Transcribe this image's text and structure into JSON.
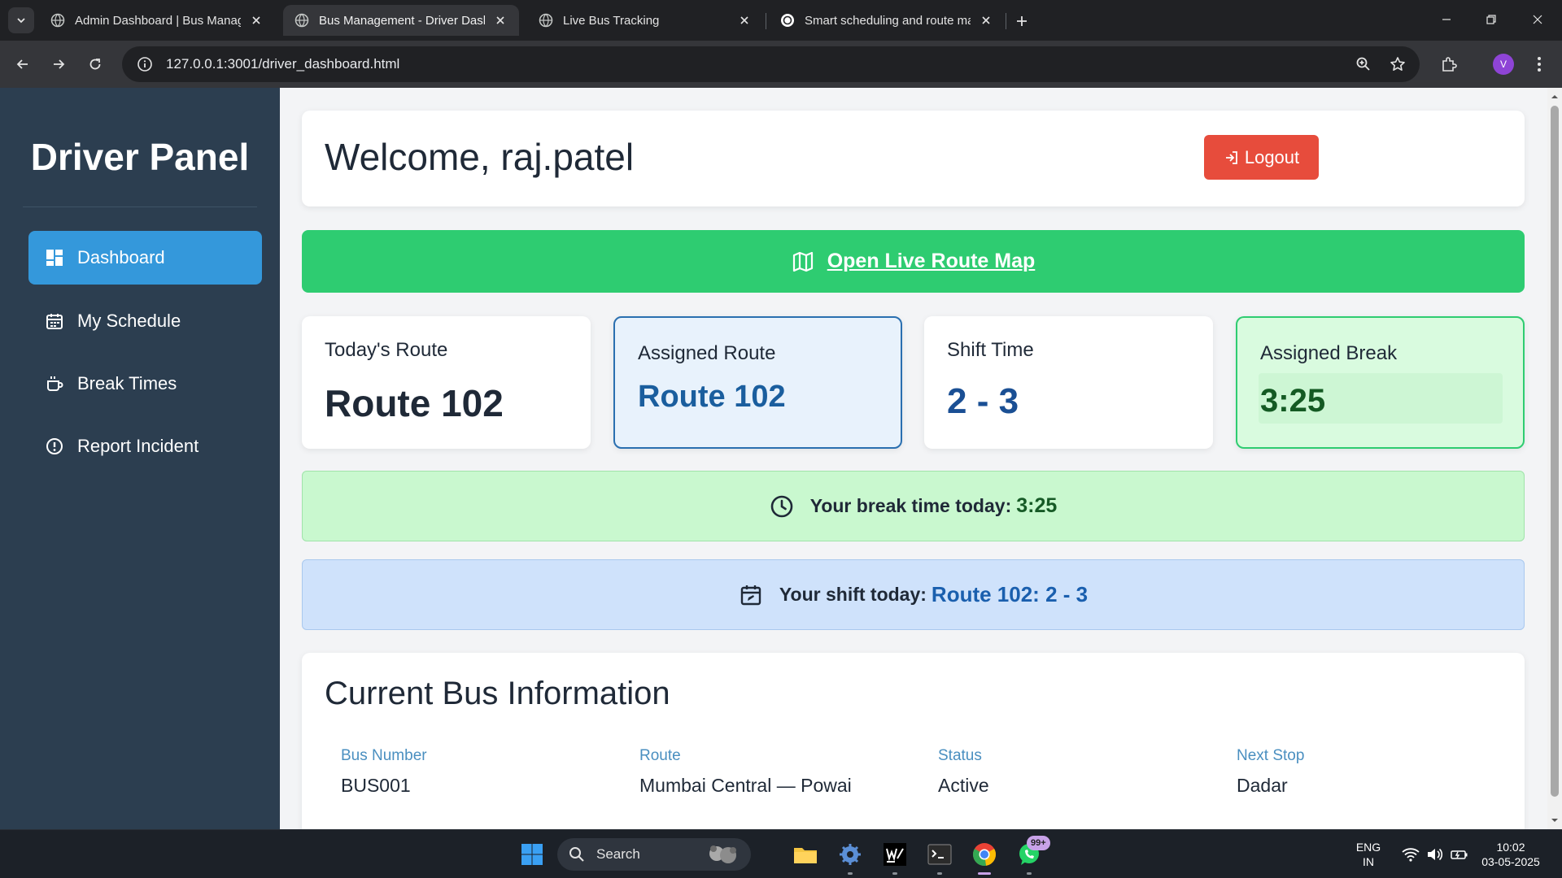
{
  "browser": {
    "tabs": [
      {
        "title": "Admin Dashboard | Bus Management",
        "active": false
      },
      {
        "title": "Bus Management - Driver Dashboard",
        "active": true
      },
      {
        "title": "Live Bus Tracking",
        "active": false
      },
      {
        "title": "Smart scheduling and route management",
        "active": false
      }
    ],
    "url": "127.0.0.1:3001/driver_dashboard.html",
    "profile_initial": "V"
  },
  "sidebar": {
    "title": "Driver Panel",
    "items": [
      {
        "label": "Dashboard",
        "icon": "dashboard-icon",
        "active": true
      },
      {
        "label": "My Schedule",
        "icon": "calendar-icon",
        "active": false
      },
      {
        "label": "Break Times",
        "icon": "coffee-icon",
        "active": false
      },
      {
        "label": "Report Incident",
        "icon": "alert-circle-icon",
        "active": false
      }
    ]
  },
  "header": {
    "welcome": "Welcome, raj.patel",
    "logout_label": "Logout"
  },
  "map_banner": {
    "label": "Open Live Route Map",
    "icon": "map-icon"
  },
  "stats": [
    {
      "label": "Today's Route",
      "value": "Route 102"
    },
    {
      "label": "Assigned Route",
      "value": "Route 102"
    },
    {
      "label": "Shift Time",
      "value": "2 - 3"
    },
    {
      "label": "Assigned Break",
      "value": "3:25"
    }
  ],
  "alerts": {
    "break": {
      "prefix": "Your break time today:",
      "value": "3:25"
    },
    "shift": {
      "prefix": "Your shift today:",
      "value": "Route 102: 2 - 3"
    }
  },
  "bus_info": {
    "title": "Current Bus Information",
    "fields": [
      {
        "label": "Bus Number",
        "value": "BUS001"
      },
      {
        "label": "Route",
        "value": "Mumbai Central — Powai"
      },
      {
        "label": "Status",
        "value": "Active"
      },
      {
        "label": "Next Stop",
        "value": "Dadar"
      }
    ]
  },
  "taskbar": {
    "search_placeholder": "Search",
    "notification_badge": "99+",
    "language": "ENG",
    "region": "IN",
    "time": "10:02",
    "date": "03-05-2025"
  },
  "colors": {
    "sidebar_bg": "#2c3e50",
    "active_item": "#3498db",
    "logout": "#e74c3c",
    "map_banner": "#2ecc71"
  }
}
